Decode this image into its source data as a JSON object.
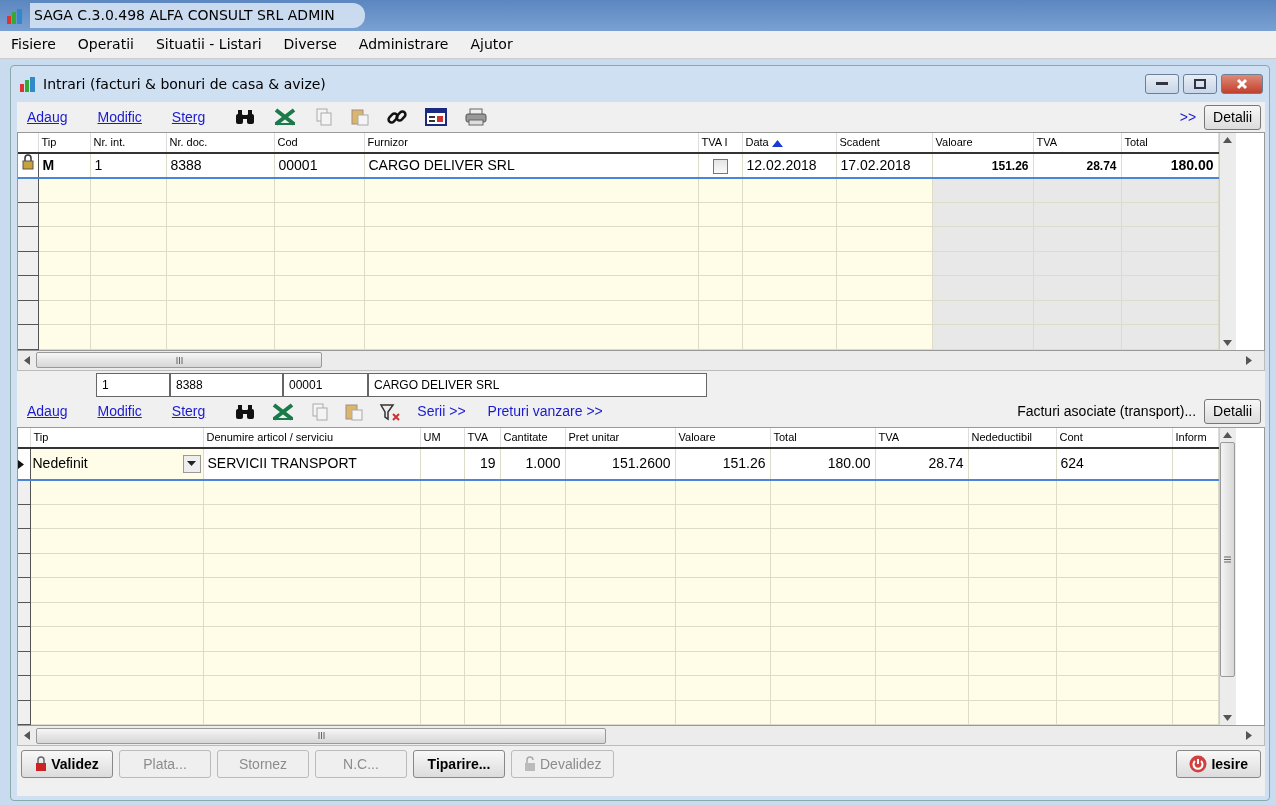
{
  "app_window": {
    "title": "SAGA C.3.0.498  ALFA CONSULT SRL  ADMIN"
  },
  "menu": [
    "Fisiere",
    "Operatii",
    "Situatii - Listari",
    "Diverse",
    "Administrare",
    "Ajutor"
  ],
  "child_window": {
    "title": "Intrari (facturi & bonuri de casa & avize)"
  },
  "invoice_toolbar": {
    "links": [
      "Adaug",
      "Modific",
      "Sterg"
    ],
    "more": ">>",
    "details_button": "Detalii"
  },
  "invoices": {
    "columns": [
      {
        "label": "Tip",
        "kind": "bold",
        "sorted": false
      },
      {
        "label": "Nr. int.",
        "kind": "text",
        "sorted": false
      },
      {
        "label": "Nr. doc.",
        "kind": "text",
        "sorted": false
      },
      {
        "label": "Cod",
        "kind": "text",
        "sorted": false
      },
      {
        "label": "Furnizor",
        "kind": "text",
        "sorted": false
      },
      {
        "label": "TVA I",
        "kind": "check",
        "sorted": false
      },
      {
        "label": "Data",
        "kind": "text",
        "sorted": true
      },
      {
        "label": "Scadent",
        "kind": "text",
        "sorted": false
      },
      {
        "label": "Valoare",
        "kind": "number",
        "sorted": false
      },
      {
        "label": "TVA",
        "kind": "number",
        "sorted": false
      },
      {
        "label": "Total",
        "kind": "total",
        "sorted": false
      }
    ],
    "rows": [
      {
        "selected": true,
        "locked": true,
        "tva_i_checked": false,
        "cells": [
          "M",
          "1",
          "8388",
          "00001",
          "CARGO DELIVER SRL",
          null,
          "12.02.2018",
          "17.02.2018",
          "151.26",
          "28.74",
          "180.00"
        ]
      }
    ]
  },
  "current_invoice": [
    "1",
    "8388",
    "00001",
    "CARGO DELIVER SRL"
  ],
  "lines_toolbar": {
    "links": [
      "Adaug",
      "Modific",
      "Sterg"
    ],
    "extra_links": [
      "Serii >>",
      "Preturi vanzare >>"
    ],
    "associated": "Facturi asociate (transport)...",
    "details_button": "Detalii"
  },
  "lines": {
    "columns": [
      {
        "label": "Tip",
        "kind": "dropdown"
      },
      {
        "label": "Denumire articol / serviciu",
        "kind": "text"
      },
      {
        "label": "UM",
        "kind": "text"
      },
      {
        "label": "TVA",
        "kind": "number"
      },
      {
        "label": "Cantitate",
        "kind": "number"
      },
      {
        "label": "Pret unitar",
        "kind": "number"
      },
      {
        "label": "Valoare",
        "kind": "number"
      },
      {
        "label": "Total",
        "kind": "number"
      },
      {
        "label": "TVA",
        "kind": "number"
      },
      {
        "label": "Nedeductibil",
        "kind": "number"
      },
      {
        "label": "Cont",
        "kind": "text"
      },
      {
        "label": "Inform",
        "kind": "text"
      }
    ],
    "rows": [
      {
        "selected": true,
        "cells": [
          "Nedefinit",
          "SERVICII TRANSPORT",
          null,
          "19",
          "1.000",
          "151.2600",
          "151.26",
          "180.00",
          "28.74",
          null,
          "624",
          null
        ]
      }
    ]
  },
  "bottom_buttons": [
    {
      "label": "Validez",
      "kind": "lock",
      "disabled": false
    },
    {
      "label": "Plata...",
      "kind": "plain",
      "disabled": true
    },
    {
      "label": "Stornez",
      "kind": "plain",
      "disabled": true
    },
    {
      "label": "N.C...",
      "kind": "plain",
      "disabled": true
    },
    {
      "label": "Tiparire...",
      "kind": "plain",
      "disabled": false
    },
    {
      "label": "Devalidez",
      "kind": "unlock",
      "disabled": true
    }
  ],
  "exit_button": {
    "label": "Iesire"
  }
}
